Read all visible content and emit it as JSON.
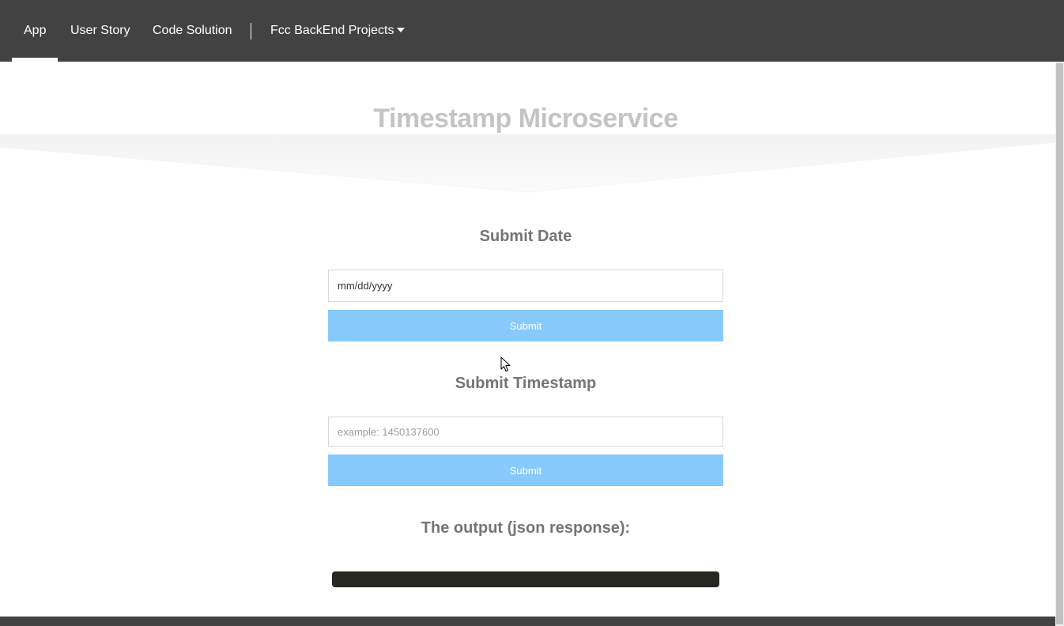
{
  "nav": {
    "items": [
      {
        "label": "App",
        "active": true
      },
      {
        "label": "User Story",
        "active": false
      },
      {
        "label": "Code Solution",
        "active": false
      }
    ],
    "dropdown_label": "Fcc BackEnd Projects"
  },
  "hero": {
    "title": "Timestamp Microservice"
  },
  "date_section": {
    "heading": "Submit Date",
    "input_value": "mm/dd/yyyy",
    "submit_label": "Submit"
  },
  "timestamp_section": {
    "heading": "Submit Timestamp",
    "input_placeholder": "example: 1450137600",
    "submit_label": "Submit"
  },
  "output_section": {
    "heading": "The output (json response):",
    "content": ""
  },
  "colors": {
    "navbar": "#424242",
    "button": "#88c9fc",
    "output_box": "#272822",
    "title": "#c4c4c4",
    "heading": "#757575"
  }
}
